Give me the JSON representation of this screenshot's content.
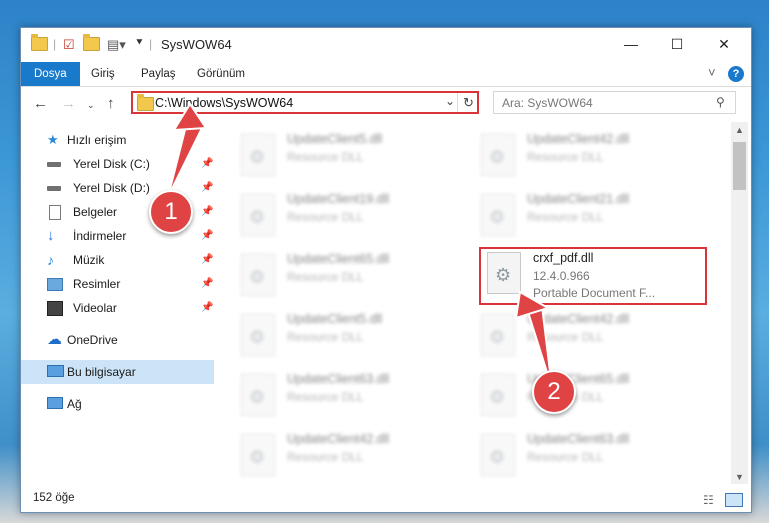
{
  "window": {
    "title": "SysWOW64",
    "close_glyph": "✕",
    "maximize_glyph": "☐",
    "minimize_glyph": "—"
  },
  "ribbon": {
    "tabs": [
      "Dosya",
      "Giriş",
      "Paylaş",
      "Görünüm"
    ],
    "expand_glyph": "˅",
    "help_glyph": "?"
  },
  "address": {
    "path": "C:\\Windows\\SysWOW64",
    "search_placeholder": "Ara: SysWOW64"
  },
  "nav": {
    "items": [
      {
        "label": "Hızlı erişim",
        "icon": "star-icon",
        "pinned": false
      },
      {
        "label": "Yerel Disk (C:)",
        "icon": "drive-icon",
        "pinned": true
      },
      {
        "label": "Yerel Disk (D:)",
        "icon": "drive-icon",
        "pinned": true
      },
      {
        "label": "Belgeler",
        "icon": "document-icon",
        "pinned": true
      },
      {
        "label": "İndirmeler",
        "icon": "download-icon",
        "pinned": true
      },
      {
        "label": "Müzik",
        "icon": "music-icon",
        "pinned": true
      },
      {
        "label": "Resimler",
        "icon": "pictures-icon",
        "pinned": true
      },
      {
        "label": "Videolar",
        "icon": "video-icon",
        "pinned": true
      },
      {
        "label": "OneDrive",
        "icon": "cloud-icon",
        "pinned": false
      },
      {
        "label": "Bu bilgisayar",
        "icon": "computer-icon",
        "pinned": false
      },
      {
        "label": "Ağ",
        "icon": "network-icon",
        "pinned": false
      }
    ],
    "pin_glyph": "📌"
  },
  "files": [
    {
      "name": "UpdateClient5.dll",
      "desc": "Resource DLL"
    },
    {
      "name": "UpdateClient42.dll",
      "desc": "Resource DLL"
    },
    {
      "name": "UpdateClient19.dll",
      "desc": "Resource DLL"
    },
    {
      "name": "UpdateClient21.dll",
      "desc": "Resource DLL"
    },
    {
      "name": "UpdateClient65.dll",
      "desc": "Resource DLL"
    },
    {
      "name": "crxf_pdf.dll",
      "version": "12.4.0.966",
      "desc": "Portable Document F..."
    },
    {
      "name": "UpdateClient5.dll",
      "desc": "Resource DLL"
    },
    {
      "name": "UpdateClient42.dll",
      "desc": "Resource DLL"
    },
    {
      "name": "UpdateClient63.dll",
      "desc": "Resource DLL"
    },
    {
      "name": "UpdateClient65.dll",
      "desc": "Resource DLL"
    },
    {
      "name": "UpdateClient42.dll",
      "desc": "Resource DLL"
    },
    {
      "name": "UpdateClient63.dll",
      "desc": "Resource DLL"
    }
  ],
  "status": {
    "item_count": "152 öğe"
  },
  "callouts": [
    "1",
    "2"
  ],
  "colors": {
    "accent": "#1979ca",
    "highlight": "#d9343a",
    "callout": "#e04343"
  }
}
